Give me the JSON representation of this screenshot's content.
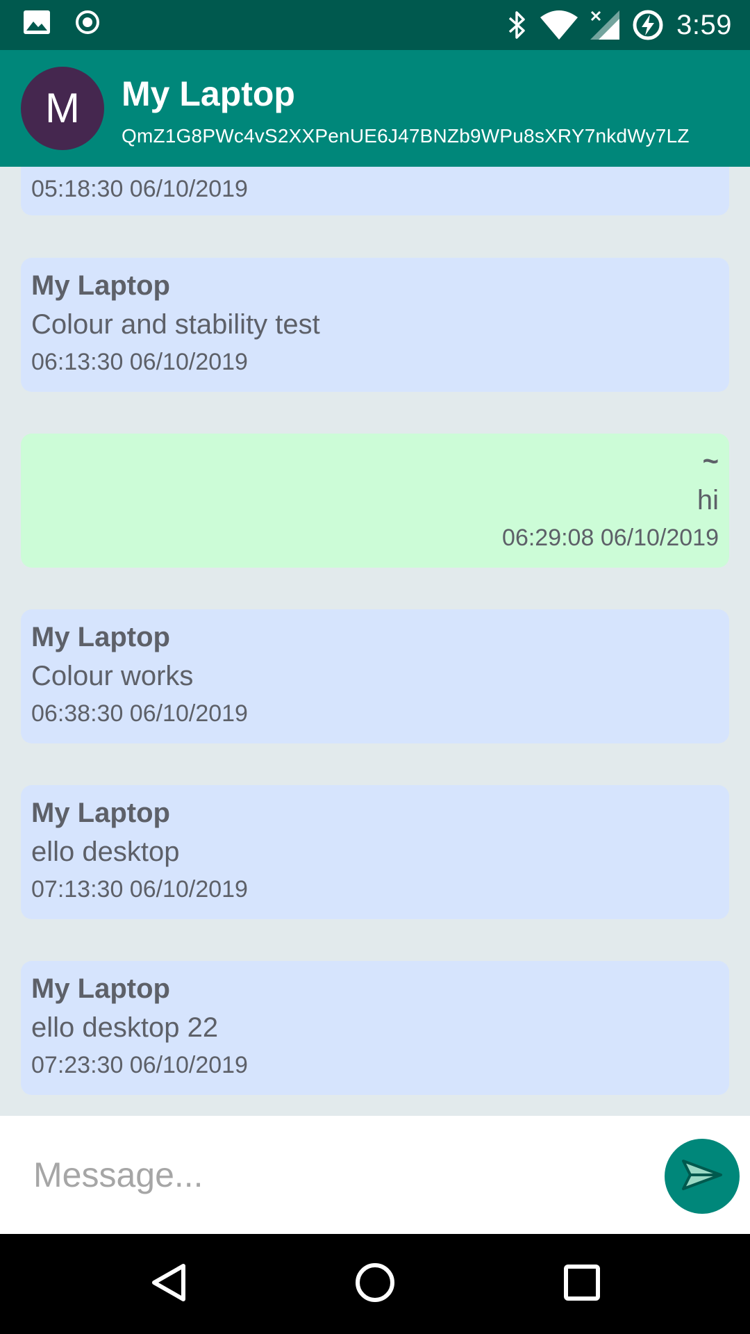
{
  "status_bar": {
    "time": "3:59",
    "left_icons": [
      "image-icon",
      "record-icon"
    ],
    "right_icons": [
      "bluetooth-icon",
      "wifi-icon",
      "cell-signal-icon",
      "battery-charging-icon"
    ]
  },
  "header": {
    "avatar_letter": "M",
    "title": "My Laptop",
    "subtitle": "QmZ1G8PWc4vS2XXPenUE6J47BNZb9WPu8sXRY7nkdWy7LZ"
  },
  "messages": [
    {
      "sender": "",
      "text": "",
      "time": "05:18:30 06/10/2019",
      "mine": false
    },
    {
      "sender": "My Laptop",
      "text": "Colour and stability test",
      "time": "06:13:30 06/10/2019",
      "mine": false
    },
    {
      "sender": "~",
      "text": "hi",
      "time": "06:29:08 06/10/2019",
      "mine": true
    },
    {
      "sender": "My Laptop",
      "text": "Colour works",
      "time": "06:38:30 06/10/2019",
      "mine": false
    },
    {
      "sender": "My Laptop",
      "text": "ello desktop",
      "time": "07:13:30 06/10/2019",
      "mine": false
    },
    {
      "sender": "My Laptop",
      "text": "ello desktop 22",
      "time": "07:23:30 06/10/2019",
      "mine": false
    }
  ],
  "composer": {
    "placeholder": "Message...",
    "value": "",
    "send_icon": "send-icon"
  },
  "nav_bar": {
    "icons": [
      "back-icon",
      "home-icon",
      "recents-icon"
    ]
  },
  "colors": {
    "status_bar": "#00594e",
    "app_bar": "#00877a",
    "avatar": "#45274f",
    "incoming_bubble": "#d6e4fd",
    "outgoing_bubble": "#ccfcd7",
    "chat_background": "#e2eaec"
  }
}
